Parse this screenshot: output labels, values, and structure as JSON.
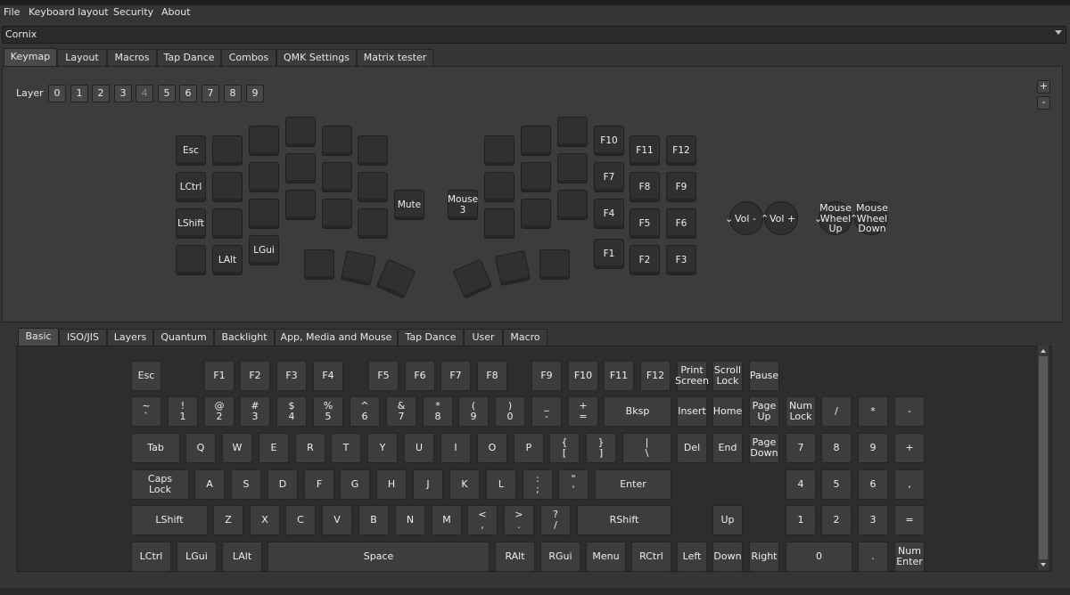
{
  "menu": [
    "File",
    "Keyboard layout",
    "Security",
    "About"
  ],
  "keyboard_select": "Cornix",
  "main_tabs": [
    "Keymap",
    "Layout",
    "Macros",
    "Tap Dance",
    "Combos",
    "QMK Settings",
    "Matrix tester"
  ],
  "layer_label": "Layer",
  "layers": [
    "0",
    "1",
    "2",
    "3",
    "4",
    "5",
    "6",
    "7",
    "8",
    "9"
  ],
  "active_layer": "4",
  "plus_label": "+",
  "minus_label": "-",
  "keymap_keys": {
    "esc": "Esc",
    "lctrl": "LCtrl",
    "lshift": "LShift",
    "lalt": "LAlt",
    "lgui": "LGui",
    "mute": "Mute",
    "mouse3": "Mouse\n3",
    "f10": "F10",
    "f11": "F11",
    "f12": "F12",
    "f7": "F7",
    "f8": "F8",
    "f9": "F9",
    "f4": "F4",
    "f5": "F5",
    "f6": "F6",
    "f1": "F1",
    "f2": "F2",
    "f3": "F3"
  },
  "encoders": {
    "vol_down": "Vol -",
    "vol_up": "Vol +",
    "wheel_up": "Mouse\nWheel\nUp",
    "wheel_down": "Mouse\nWheel\nDown"
  },
  "bottom_tabs": [
    "Basic",
    "ISO/JIS",
    "Layers",
    "Quantum",
    "Backlight",
    "App, Media and Mouse",
    "Tap Dance",
    "User",
    "Macro"
  ],
  "basic_keys": {
    "row0": [
      "Esc",
      "F1",
      "F2",
      "F3",
      "F4",
      "F5",
      "F6",
      "F7",
      "F8",
      "F9",
      "F10",
      "F11",
      "F12",
      "Print\nScreen",
      "Scroll\nLock",
      "Pause"
    ],
    "row1": [
      "~\n`",
      "!\n1",
      "@\n2",
      "#\n3",
      "$\n4",
      "%\n5",
      "^\n6",
      "&\n7",
      "*\n8",
      "(\n9",
      ")\n0",
      "_\n-",
      "+\n=",
      "Bksp",
      "Insert",
      "Home",
      "Page\nUp",
      "Num\nLock",
      "/",
      "*",
      "-"
    ],
    "row2": [
      "Tab",
      "Q",
      "W",
      "E",
      "R",
      "T",
      "Y",
      "U",
      "I",
      "O",
      "P",
      "{\n[",
      "}\n]",
      "|\n\\",
      "Del",
      "End",
      "Page\nDown",
      "7",
      "8",
      "9",
      "+"
    ],
    "row3": [
      "Caps\nLock",
      "A",
      "S",
      "D",
      "F",
      "G",
      "H",
      "J",
      "K",
      "L",
      ":\n;",
      "\"\n'",
      "Enter",
      "4",
      "5",
      "6",
      ","
    ],
    "row4": [
      "LShift",
      "Z",
      "X",
      "C",
      "V",
      "B",
      "N",
      "M",
      "<\n,",
      ">\n.",
      "?\n/",
      "RShift",
      "Up",
      "1",
      "2",
      "3",
      "="
    ],
    "row5": [
      "LCtrl",
      "LGui",
      "LAlt",
      "Space",
      "RAlt",
      "RGui",
      "Menu",
      "RCtrl",
      "Left",
      "Down",
      "Right",
      "0",
      ".",
      "Num\nEnter"
    ]
  }
}
